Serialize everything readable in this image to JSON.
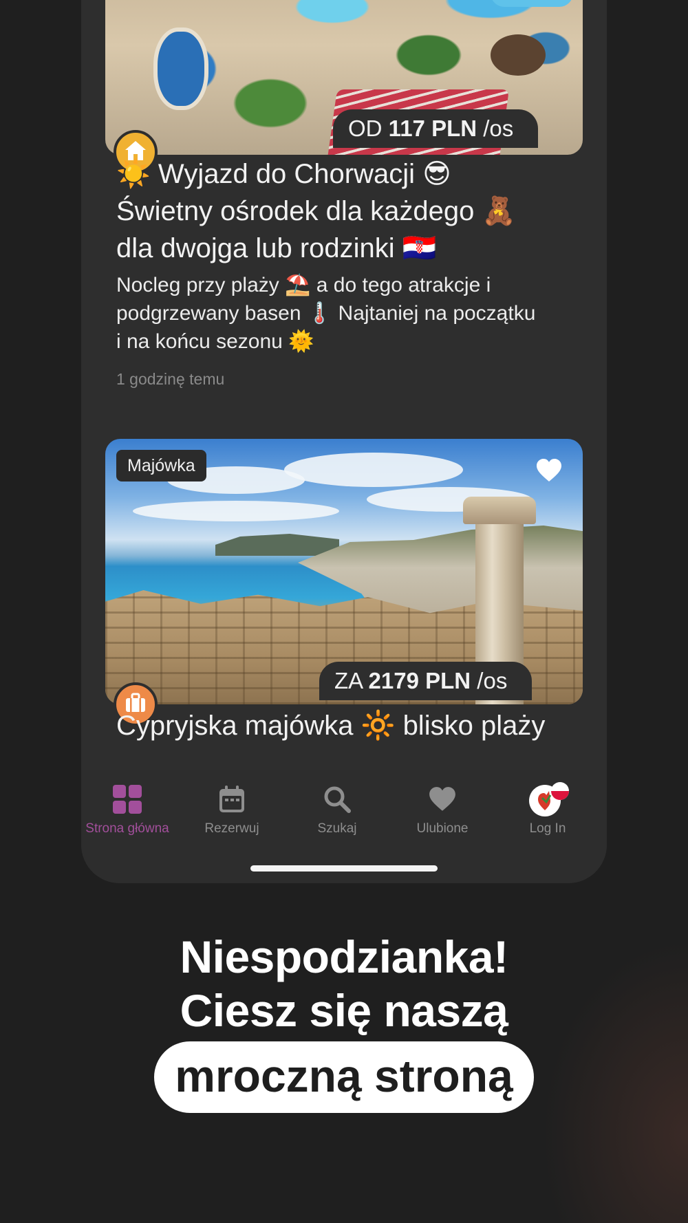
{
  "cards": [
    {
      "price_prefix": "OD",
      "price_value": "117 PLN",
      "price_suffix": "/os",
      "badge_icon": "home-icon",
      "title_line1": "☀️ Wyjazd do Chorwacji 😎",
      "title_line2": "Świetny ośrodek dla każdego 🧸",
      "title_line3": "dla dwojga lub rodzinki 🇭🇷",
      "desc_line1": "Nocleg przy plaży ⛱️ a do tego atrakcje i",
      "desc_line2": "podgrzewany basen 🌡️ Najtaniej na początku",
      "desc_line3": "i na końcu sezonu 🌞",
      "time": "1 godzinę temu"
    },
    {
      "tag": "Majówka",
      "price_prefix": "ZA",
      "price_value": "2179 PLN",
      "price_suffix": "/os",
      "badge_icon": "suitcase-icon",
      "title": "Cypryjska majówka 🔆 blisko plaży"
    }
  ],
  "tabs": [
    {
      "label": "Strona główna",
      "icon": "grid-icon",
      "active": true
    },
    {
      "label": "Rezerwuj",
      "icon": "calendar-icon",
      "active": false
    },
    {
      "label": "Szukaj",
      "icon": "search-icon",
      "active": false
    },
    {
      "label": "Ulubione",
      "icon": "heart-icon",
      "active": false
    },
    {
      "label": "Log In",
      "icon": "avatar-icon",
      "active": false
    }
  ],
  "promo": {
    "line1": "Niespodzianka!",
    "line2": "Ciesz się naszą",
    "highlight": "mroczną stroną"
  },
  "colors": {
    "accent": "#a24f9b",
    "badge_home": "#f0b132",
    "badge_suitcase": "#ee8a48",
    "background": "#1c1c1c",
    "card_surface": "#2e2e2e"
  }
}
